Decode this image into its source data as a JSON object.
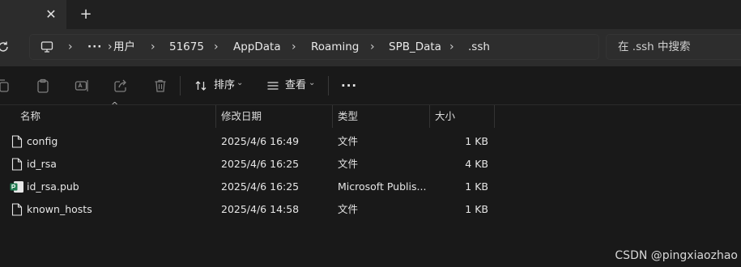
{
  "tabs": {
    "close_icon": "close-icon",
    "new_tab_icon": "plus-icon",
    "close_glyph": "✕",
    "new_glyph": "+"
  },
  "address": {
    "refresh_icon": "refresh-icon",
    "computer_icon": "monitor-icon",
    "overflow": "···",
    "crumbs": [
      "用户",
      "51675",
      "AppData",
      "Roaming",
      "SPB_Data",
      ".ssh"
    ],
    "chevron": "›"
  },
  "search": {
    "placeholder": "在 .ssh 中搜索"
  },
  "toolbar": {
    "icons": [
      "copy-icon",
      "paste-icon",
      "rename-icon",
      "share-icon",
      "delete-icon"
    ],
    "sort_label": "排序",
    "view_label": "查看",
    "more_label": "···",
    "dropdown": "⌄"
  },
  "columns": {
    "name": "名称",
    "modified": "修改日期",
    "type": "类型",
    "size": "大小",
    "sort_caret": "^"
  },
  "files": [
    {
      "name": "config",
      "modified": "2025/4/6 16:49",
      "type": "文件",
      "size": "1 KB",
      "icon": "file-icon"
    },
    {
      "name": "id_rsa",
      "modified": "2025/4/6 16:25",
      "type": "文件",
      "size": "4 KB",
      "icon": "file-icon"
    },
    {
      "name": "id_rsa.pub",
      "modified": "2025/4/6 16:25",
      "type": "Microsoft Publis...",
      "size": "1 KB",
      "icon": "publisher-file-icon"
    },
    {
      "name": "known_hosts",
      "modified": "2025/4/6 14:58",
      "type": "文件",
      "size": "1 KB",
      "icon": "file-icon"
    }
  ],
  "watermark": "CSDN @pingxiaozhao",
  "colors": {
    "background": "#191919",
    "chrome": "#202020",
    "publisher_accent": "#1e7a4f"
  }
}
